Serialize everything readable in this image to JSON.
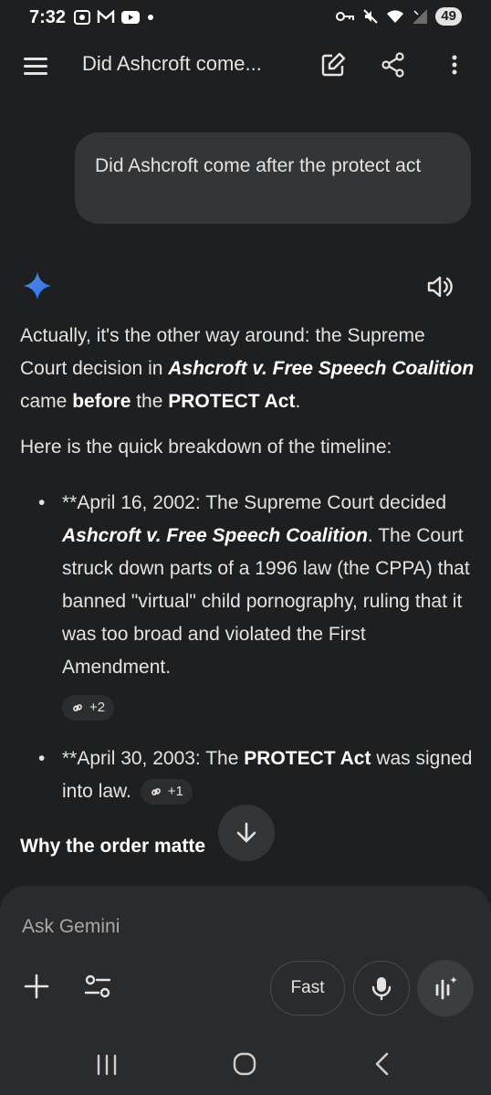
{
  "status_bar": {
    "time": "7:32",
    "battery": "49"
  },
  "header": {
    "title": "Did Ashcroft come..."
  },
  "user_message": {
    "text": "Did Ashcroft come after the protect act"
  },
  "response": {
    "intro_1": "Actually, it's the other way around: the Supreme Court decision in ",
    "case_name": "Ashcroft v. Free Speech Coalition",
    "intro_2": " came ",
    "before": "before",
    "intro_3": " the ",
    "protect_act": "PROTECT Act",
    "intro_4": ".",
    "breakdown": "Here is the quick breakdown of the timeline:",
    "bullet_1_a": "**April 16, 2002: The Supreme Court decided ",
    "bullet_1_case": "Ashcroft v. Free Speech Coalition",
    "bullet_1_b": ". The Court struck down parts of a 1996 law (the CPPA) that banned \"virtual\" child pornography, ruling that it was too broad and violated the First Amendment.",
    "bullet_1_chip": "+2",
    "bullet_2_a": "**April 30, 2003: The ",
    "bullet_2_bold": "PROTECT Act",
    "bullet_2_b": " was signed into law.",
    "bullet_2_chip": "+1",
    "why_heading": "Why the order matte"
  },
  "composer": {
    "placeholder": "Ask Gemini",
    "fast_label": "Fast"
  },
  "colors": {
    "background": "#1e1f20",
    "bubble": "#333537",
    "composer": "#2a2b2d",
    "gemini_blue": "#4285f4"
  }
}
